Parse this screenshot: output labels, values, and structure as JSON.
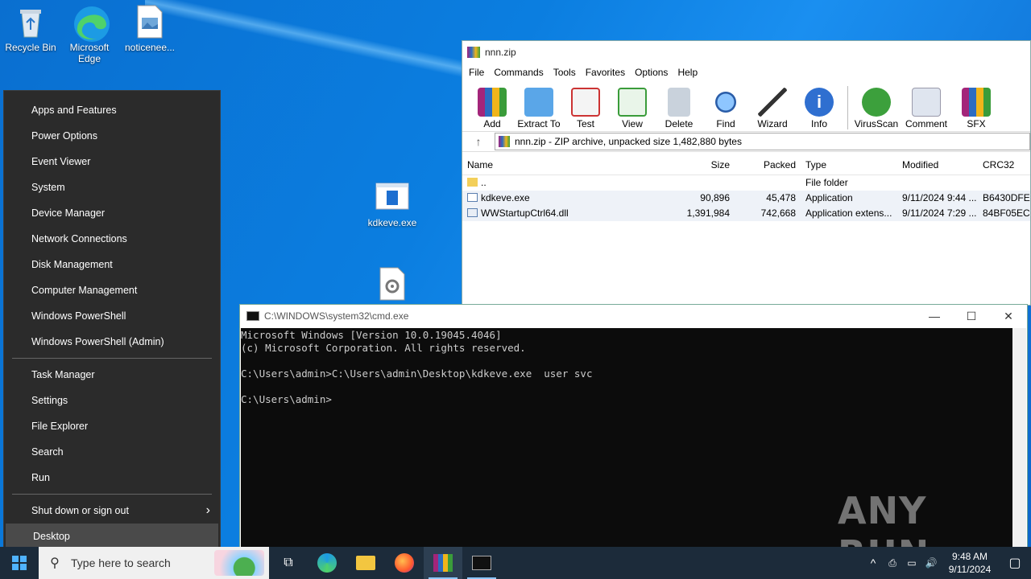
{
  "desktop": {
    "icons": [
      {
        "label": "Recycle Bin"
      },
      {
        "label": "Microsoft Edge"
      },
      {
        "label": "noticenee..."
      },
      {
        "label": "kdkeve.exe"
      }
    ]
  },
  "winx_menu": {
    "group1": [
      "Apps and Features",
      "Power Options",
      "Event Viewer",
      "System",
      "Device Manager",
      "Network Connections",
      "Disk Management",
      "Computer Management",
      "Windows PowerShell",
      "Windows PowerShell (Admin)"
    ],
    "group2": [
      "Task Manager",
      "Settings",
      "File Explorer",
      "Search",
      "Run"
    ],
    "shutdown": "Shut down or sign out",
    "desktop": "Desktop"
  },
  "winrar": {
    "title": "nnn.zip",
    "menu": [
      "File",
      "Commands",
      "Tools",
      "Favorites",
      "Options",
      "Help"
    ],
    "toolbar": [
      "Add",
      "Extract To",
      "Test",
      "View",
      "Delete",
      "Find",
      "Wizard",
      "Info",
      "VirusScan",
      "Comment",
      "SFX"
    ],
    "path": "nnn.zip - ZIP archive, unpacked size 1,482,880 bytes",
    "columns": [
      "Name",
      "Size",
      "Packed",
      "Type",
      "Modified",
      "CRC32"
    ],
    "rows": [
      {
        "name": "..",
        "size": "",
        "packed": "",
        "type": "File folder",
        "modified": "",
        "crc": ""
      },
      {
        "name": "kdkeve.exe",
        "size": "90,896",
        "packed": "45,478",
        "type": "Application",
        "modified": "9/11/2024 9:44 ...",
        "crc": "B6430DFE"
      },
      {
        "name": "WWStartupCtrl64.dll",
        "size": "1,391,984",
        "packed": "742,668",
        "type": "Application extens...",
        "modified": "9/11/2024 7:29 ...",
        "crc": "84BF05EC"
      }
    ]
  },
  "cmd": {
    "title": "C:\\WINDOWS\\system32\\cmd.exe",
    "lines": [
      "Microsoft Windows [Version 10.0.19045.4046]",
      "(c) Microsoft Corporation. All rights reserved.",
      "",
      "C:\\Users\\admin>C:\\Users\\admin\\Desktop\\kdkeve.exe  user svc",
      "",
      "C:\\Users\\admin>"
    ]
  },
  "watermark": "ANY RUN",
  "taskbar": {
    "search_placeholder": "Type here to search",
    "time": "9:48 AM",
    "date": "9/11/2024"
  }
}
